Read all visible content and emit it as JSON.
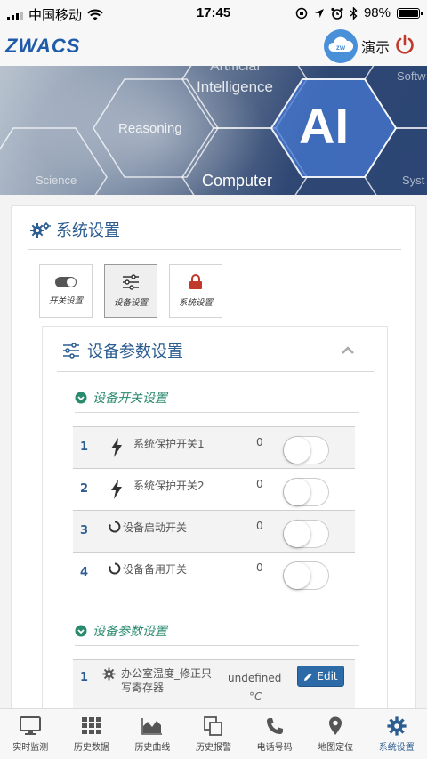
{
  "status_bar": {
    "carrier": "中国移动",
    "time": "17:45",
    "battery": "98%",
    "battery_level": 0.98
  },
  "header": {
    "logo": "ZWACS",
    "demo_badge": "zw",
    "demo_label": "演示"
  },
  "banner": {
    "words": [
      "Artificial",
      "Intelligence",
      "Reasoning",
      "Science",
      "Computer",
      "AI",
      "Softw",
      "Syst"
    ]
  },
  "card": {
    "title": "系统设置",
    "tabs": [
      {
        "label": "开关设置",
        "icon": "toggle-icon"
      },
      {
        "label": "设备设置",
        "icon": "sliders-icon"
      },
      {
        "label": "系统设置",
        "icon": "lock-icon"
      }
    ],
    "active_tab": 1,
    "panel": {
      "title": "设备参数设置",
      "switch_section": {
        "title": "设备开关设置",
        "rows": [
          {
            "index": "1",
            "name": "系统保护开关1",
            "value": "0",
            "icon": "bolt-icon",
            "on": false
          },
          {
            "index": "2",
            "name": "系统保护开关2",
            "value": "0",
            "icon": "bolt-icon",
            "on": false
          },
          {
            "index": "3",
            "name": "设备启动开关",
            "value": "0",
            "icon": "circle-notch-icon",
            "on": false
          },
          {
            "index": "4",
            "name": "设备备用开关",
            "value": "0",
            "icon": "circle-notch-icon",
            "on": false
          }
        ]
      },
      "param_section": {
        "title": "设备参数设置",
        "rows": [
          {
            "index": "1",
            "name": "办公室温度_修正只写寄存器",
            "value": "undefined",
            "unit": "°C",
            "edit_label": "Edit",
            "icon": "gear-icon"
          }
        ]
      }
    }
  },
  "bottom_nav": [
    {
      "label": "实时监测",
      "icon": "monitor-icon"
    },
    {
      "label": "历史数据",
      "icon": "grid-icon"
    },
    {
      "label": "历史曲线",
      "icon": "area-chart-icon"
    },
    {
      "label": "历史报警",
      "icon": "copy-icon"
    },
    {
      "label": "电话号码",
      "icon": "phone-icon"
    },
    {
      "label": "地图定位",
      "icon": "map-pin-icon"
    },
    {
      "label": "系统设置",
      "icon": "gear-icon"
    }
  ],
  "colors": {
    "brand": "#1f5ba8",
    "title": "#2c5d91",
    "section": "#2a8a6e",
    "power": "#c0392b",
    "edit_button": "#2d6aa8"
  }
}
